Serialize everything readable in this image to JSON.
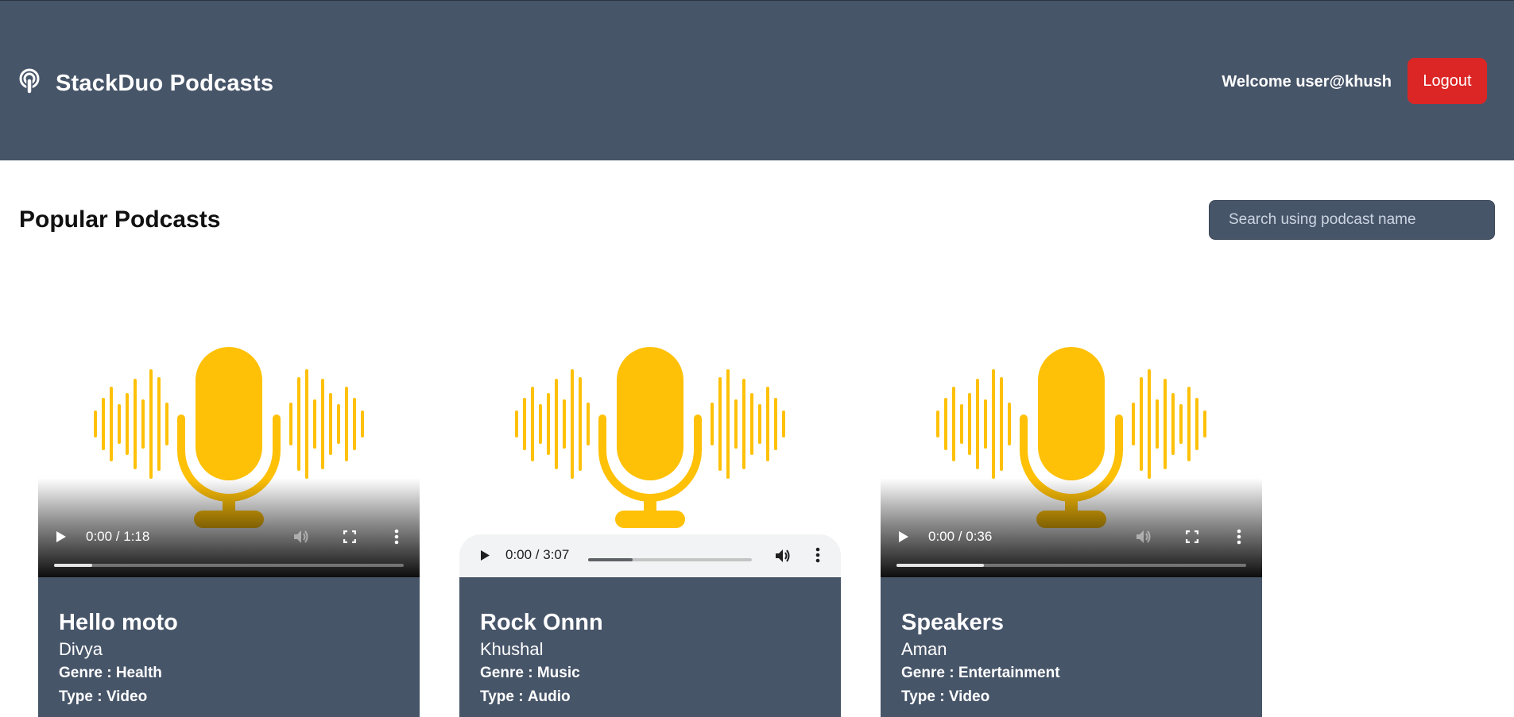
{
  "header": {
    "brand_icon": "podcast-icon",
    "title": "StackDuo Podcasts",
    "welcome": "Welcome user@khush",
    "logout_label": "Logout"
  },
  "main": {
    "heading": "Popular Podcasts",
    "search_placeholder": "Search using podcast name",
    "search_value": ""
  },
  "podcasts": [
    {
      "title": "Hello moto",
      "author": "Divya",
      "genre_label": "Genre :",
      "genre": "Health",
      "type_label": "Type :",
      "type": "Video",
      "player": "video",
      "time": "0:00 / 1:18",
      "progress": 0.11
    },
    {
      "title": "Rock Onnn",
      "author": "Khushal",
      "genre_label": "Genre :",
      "genre": "Music",
      "type_label": "Type :",
      "type": "Audio",
      "player": "audio",
      "time": "0:00 / 3:07",
      "progress": 0.27
    },
    {
      "title": "Speakers",
      "author": "Aman",
      "genre_label": "Genre :",
      "genre": "Entertainment",
      "type_label": "Type :",
      "type": "Video",
      "player": "video",
      "time": "0:00 / 0:36",
      "progress": 0.25
    }
  ],
  "colors": {
    "navbar": "#475569",
    "logout": "#dc2626",
    "mic": "#ffc107",
    "card_info": "#475569"
  }
}
